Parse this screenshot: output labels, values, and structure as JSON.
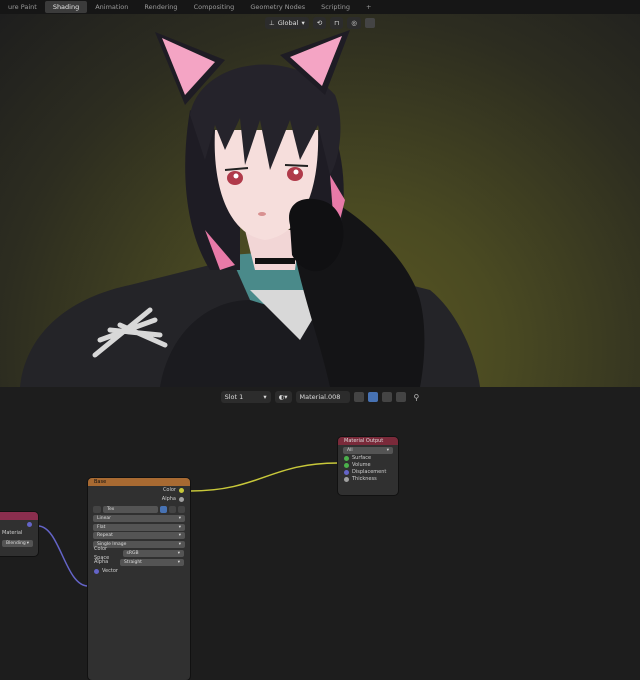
{
  "workspace_tabs": [
    "ure Paint",
    "Shading",
    "Animation",
    "Rendering",
    "Compositing",
    "Geometry Nodes",
    "Scripting",
    "+"
  ],
  "active_tab": "Shading",
  "viewport_header": {
    "orientation_label": "Global"
  },
  "node_header": {
    "slot_label": "Slot 1",
    "material_name": "Material.008"
  },
  "nodes": {
    "material_output": {
      "title": "Material Output",
      "target": "All",
      "inputs": [
        "Surface",
        "Volume",
        "Displacement",
        "Thickness"
      ]
    },
    "main_node": {
      "title": "Base",
      "outputs": [
        "Color",
        "Alpha"
      ],
      "image_field": "Tex",
      "dropdowns": [
        "Linear",
        "Flat",
        "Repeat",
        "Single Image"
      ],
      "color_space_label": "Color Space",
      "color_space_value": "sRGB",
      "alpha_label": "Alpha",
      "alpha_value": "Straight",
      "vector_label": "Vector"
    },
    "left_node": {
      "rows": [
        "Material",
        "Blending"
      ]
    }
  },
  "colors": {
    "accent": "#4772b3",
    "image_node_header": "#a86a32",
    "output_node_header": "#7a2a3a",
    "left_node_header": "#8a2e4e",
    "color_link": "#c8c83a",
    "vector_link": "#6464c8"
  }
}
